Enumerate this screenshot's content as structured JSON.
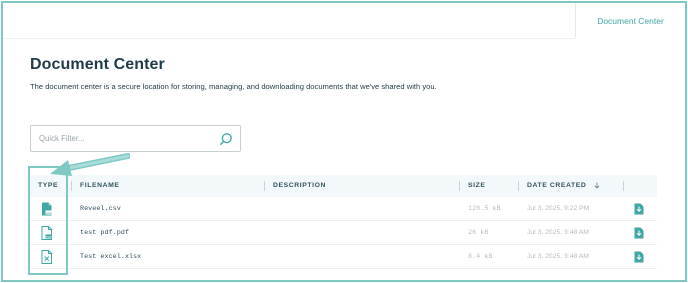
{
  "header": {
    "tab_label": "Document Center"
  },
  "page": {
    "title": "Document Center",
    "description": "The document center is a secure location for storing, managing, and downloading documents that we've shared with you."
  },
  "filter": {
    "placeholder": "Quick Filter...",
    "icon": "search-icon"
  },
  "table": {
    "columns": {
      "type": "TYPE",
      "filename": "FILENAME",
      "description": "DESCRIPTION",
      "size": "SIZE",
      "date_created": "DATE CREATED"
    },
    "sort": {
      "column": "date_created",
      "direction": "descending"
    },
    "rows": [
      {
        "type": "csv",
        "filename": "Reveel.csv",
        "description": "",
        "size": "128.5 kB",
        "date_created": "Jul 3, 2025, 9:22 PM"
      },
      {
        "type": "pdf",
        "filename": "test pdf.pdf",
        "description": "",
        "size": "26 kB",
        "date_created": "Jul 3, 2025, 3:48 AM"
      },
      {
        "type": "xlsx",
        "filename": "Test excel.xlsx",
        "description": "",
        "size": "8.4 kB",
        "date_created": "Jul 3, 2025, 3:48 AM"
      }
    ]
  },
  "colors": {
    "accent": "#3fa7a5",
    "highlight": "#7fc9c4",
    "title": "#1f3b47",
    "header_bg": "#f3f9fa"
  }
}
